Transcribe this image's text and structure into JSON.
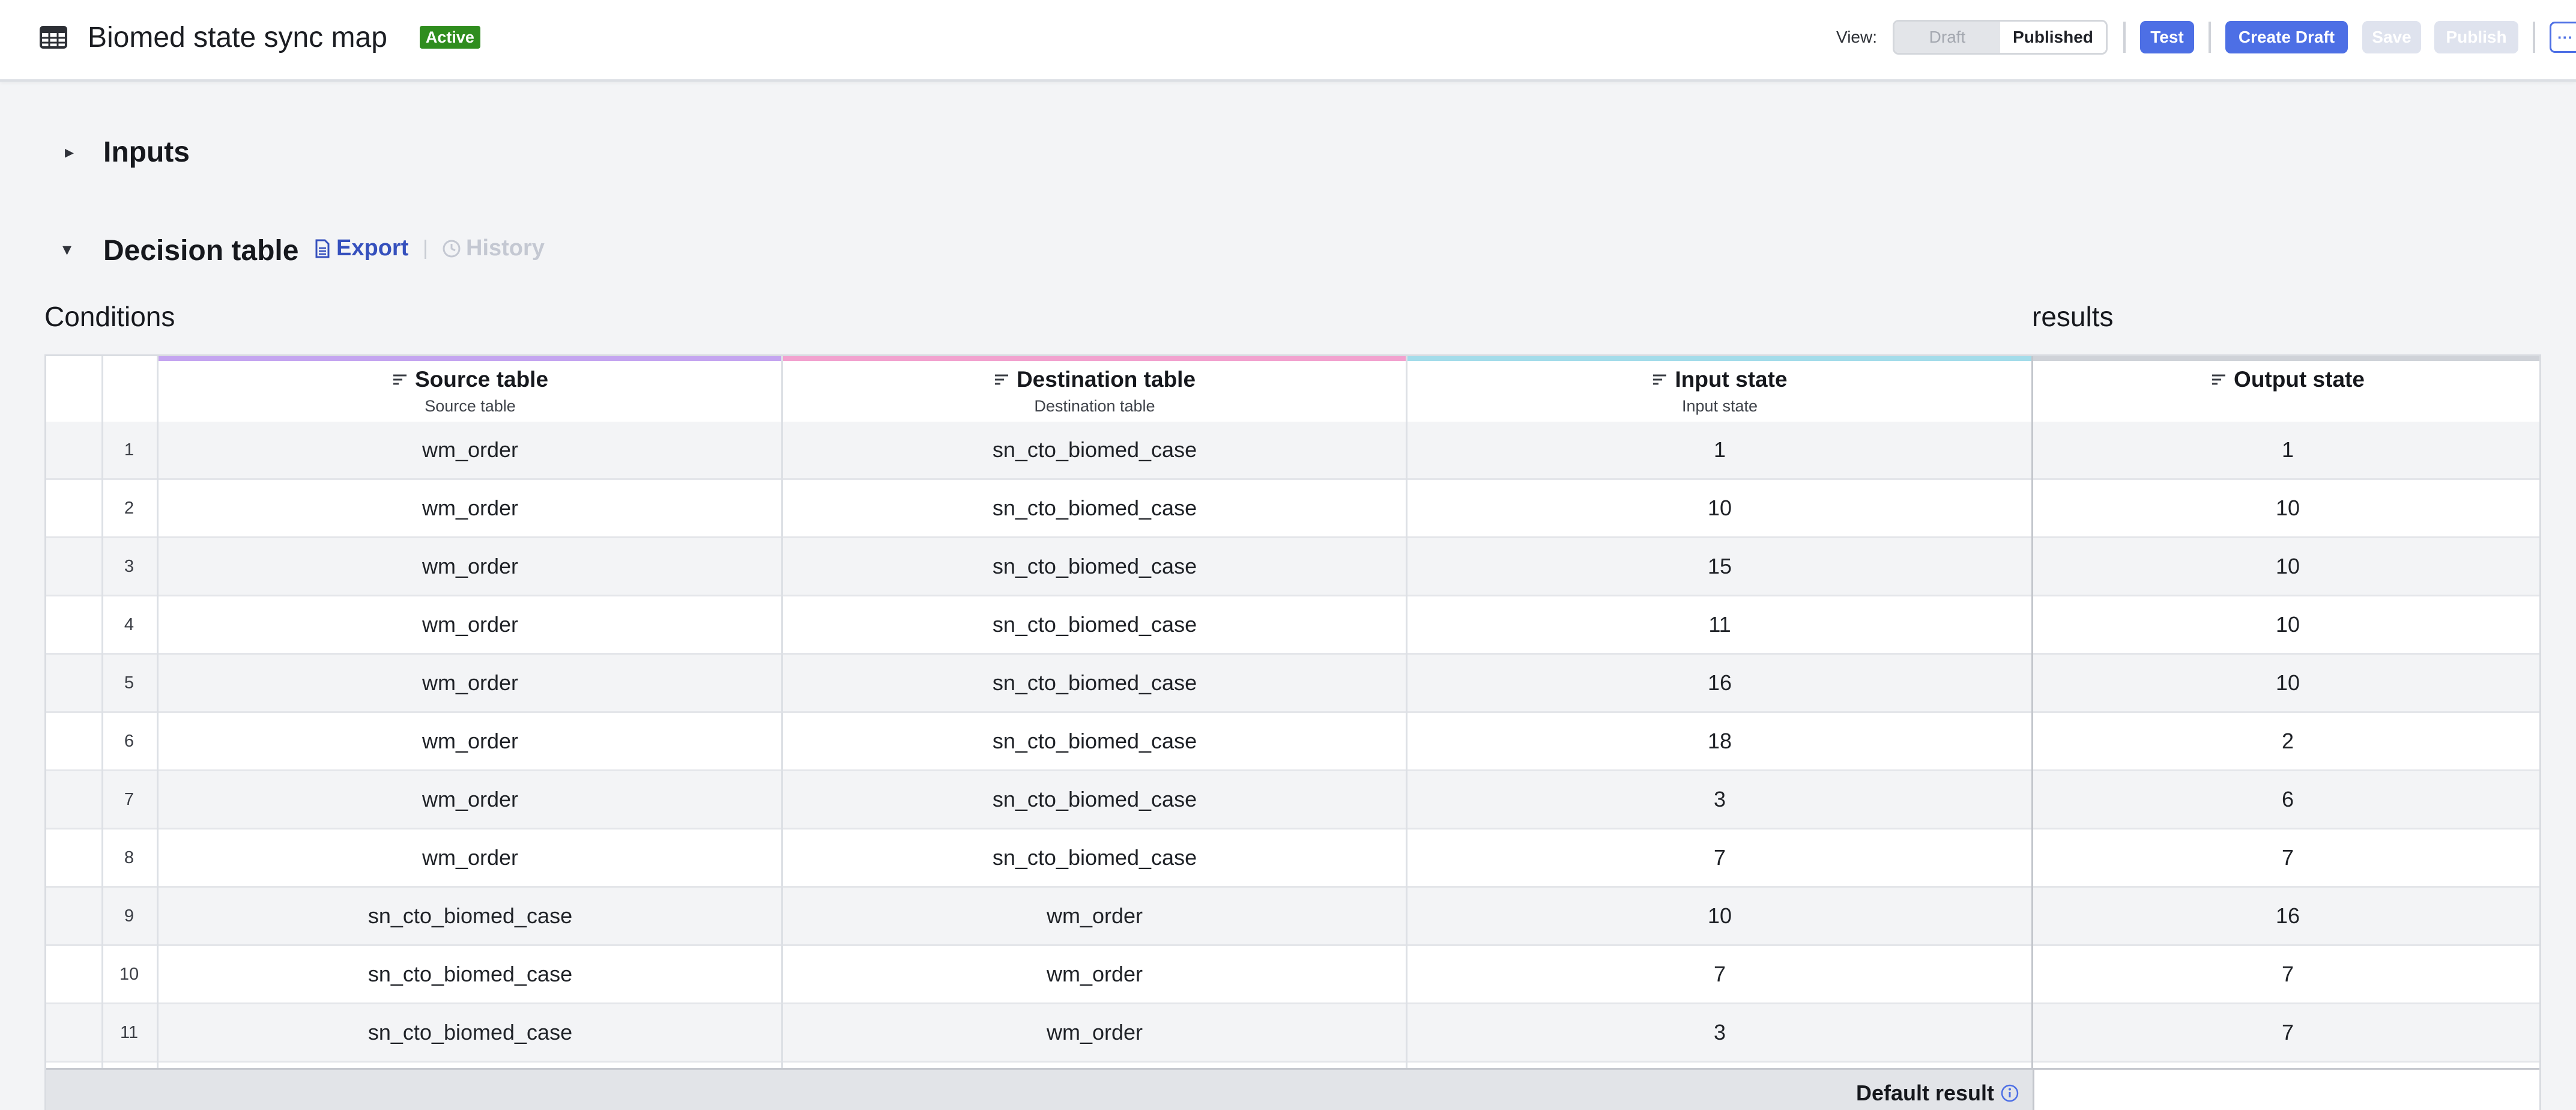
{
  "header": {
    "title": "Biomed state sync map",
    "status_badge": "Active",
    "view_label": "View:",
    "view_options": [
      "Draft",
      "Published"
    ],
    "view_selected": "Published",
    "test_label": "Test",
    "create_draft_label": "Create Draft",
    "save_label": "Save",
    "publish_label": "Publish",
    "more_label": "···"
  },
  "sections": {
    "inputs_title": "Inputs",
    "decision_title": "Decision table",
    "export_label": "Export",
    "separator": "|",
    "history_label": "History"
  },
  "table": {
    "conditions_label": "Conditions",
    "results_label": "results",
    "columns": [
      {
        "title": "Source table",
        "subtitle": "Source table",
        "accent": "#c4a5f0"
      },
      {
        "title": "Destination table",
        "subtitle": "Destination table",
        "accent": "#f2a2cf"
      },
      {
        "title": "Input state",
        "subtitle": "Input state",
        "accent": "#a3dcea"
      },
      {
        "title": "Output state",
        "subtitle": "",
        "accent": "#cfd2d8"
      }
    ],
    "rows": [
      {
        "n": "1",
        "source": "wm_order",
        "dest": "sn_cto_biomed_case",
        "input": "1",
        "output": "1"
      },
      {
        "n": "2",
        "source": "wm_order",
        "dest": "sn_cto_biomed_case",
        "input": "10",
        "output": "10"
      },
      {
        "n": "3",
        "source": "wm_order",
        "dest": "sn_cto_biomed_case",
        "input": "15",
        "output": "10"
      },
      {
        "n": "4",
        "source": "wm_order",
        "dest": "sn_cto_biomed_case",
        "input": "11",
        "output": "10"
      },
      {
        "n": "5",
        "source": "wm_order",
        "dest": "sn_cto_biomed_case",
        "input": "16",
        "output": "10"
      },
      {
        "n": "6",
        "source": "wm_order",
        "dest": "sn_cto_biomed_case",
        "input": "18",
        "output": "2"
      },
      {
        "n": "7",
        "source": "wm_order",
        "dest": "sn_cto_biomed_case",
        "input": "3",
        "output": "6"
      },
      {
        "n": "8",
        "source": "wm_order",
        "dest": "sn_cto_biomed_case",
        "input": "7",
        "output": "7"
      },
      {
        "n": "9",
        "source": "sn_cto_biomed_case",
        "dest": "wm_order",
        "input": "10",
        "output": "16"
      },
      {
        "n": "10",
        "source": "sn_cto_biomed_case",
        "dest": "wm_order",
        "input": "7",
        "output": "7"
      },
      {
        "n": "11",
        "source": "sn_cto_biomed_case",
        "dest": "wm_order",
        "input": "3",
        "output": "7"
      }
    ],
    "default_result_label": "Default result"
  },
  "colors": {
    "primary": "#4d6fe5",
    "badge": "#2f8d1e",
    "link": "#3550bd"
  }
}
